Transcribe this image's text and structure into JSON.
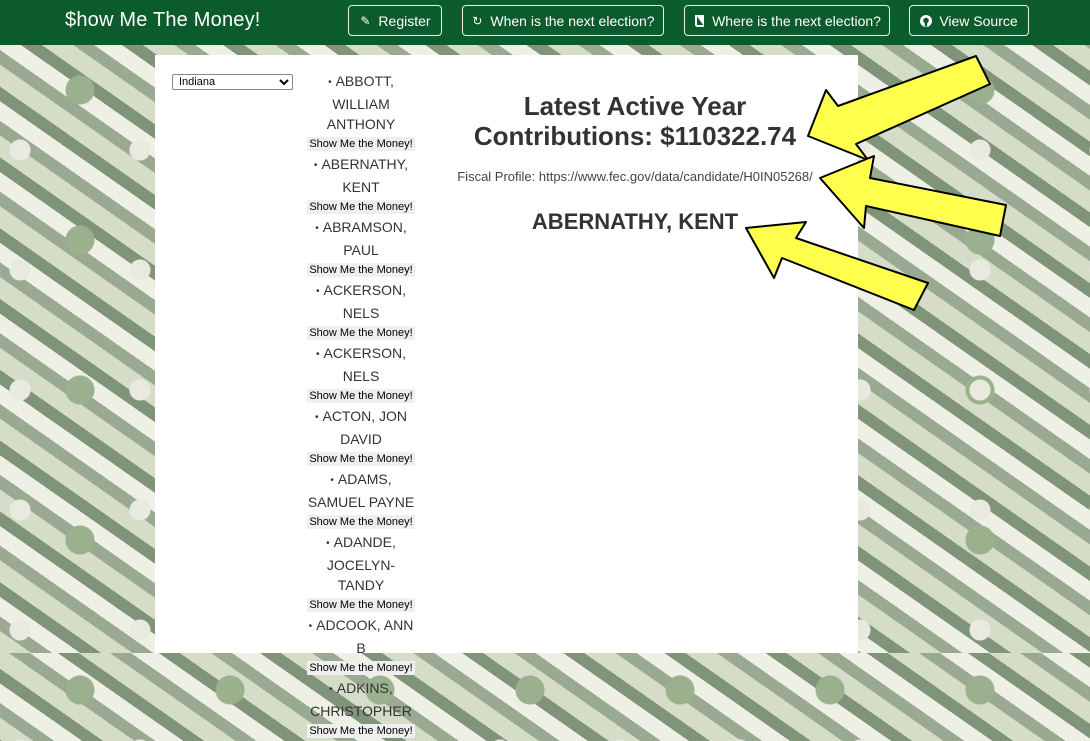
{
  "navbar": {
    "brand": "$how Me The Money!",
    "buttons": [
      {
        "label": "Register",
        "icon": "pencil-icon"
      },
      {
        "label": "When is the next election?",
        "icon": "refresh-icon"
      },
      {
        "label": "Where is the next election?",
        "icon": "book-icon"
      },
      {
        "label": "View Source",
        "icon": "github-icon"
      }
    ]
  },
  "state_select": {
    "value": "Indiana"
  },
  "candidates": [
    {
      "name": "ABBOTT, WILLIAM ANTHONY"
    },
    {
      "name": "ABERNATHY, KENT"
    },
    {
      "name": "ABRAMSON, PAUL"
    },
    {
      "name": "ACKERSON, NELS"
    },
    {
      "name": "ACKERSON, NELS"
    },
    {
      "name": "ACTON, JON DAVID"
    },
    {
      "name": "ADAMS, SAMUEL PAYNE"
    },
    {
      "name": "ADANDE, JOCELYN-TANDY"
    },
    {
      "name": "ADCOOK, ANN B"
    },
    {
      "name": "ADKINS, CHRISTOPHER"
    }
  ],
  "show_button_label": "Show Me the Money!",
  "summary": {
    "contributions": "Latest Active Year Contributions: $110322.74",
    "fiscal_profile": "Fiscal Profile: https://www.fec.gov/data/candidate/H0IN05268/",
    "candidate": "ABERNATHY, KENT"
  },
  "colors": {
    "navbar": "#0c5b2c",
    "arrow_fill": "#ffff4d",
    "arrow_stroke": "#000000"
  }
}
